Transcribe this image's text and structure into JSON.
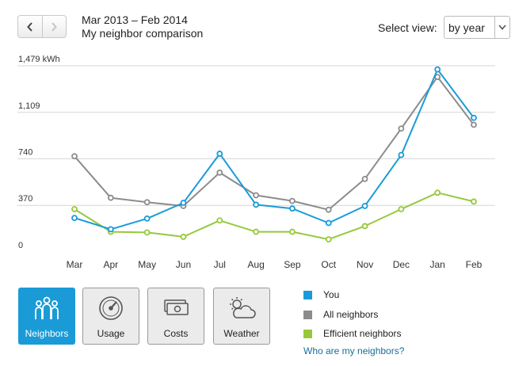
{
  "header": {
    "period": "Mar 2013 – Feb 2014",
    "subtitle": "My neighbor comparison",
    "nav": {
      "prev_icon": "chevron-left-icon",
      "next_icon": "chevron-right-icon"
    },
    "select_label": "Select view:",
    "select_value": "by year"
  },
  "chart_data": {
    "type": "line",
    "unit": "kWh",
    "y_ticks": [
      "0",
      "370",
      "740",
      "1,109",
      "1,479 kWh"
    ],
    "y_tick_values": [
      0,
      370,
      740,
      1109,
      1479
    ],
    "ylim": [
      0,
      1479
    ],
    "categories": [
      "Mar",
      "Apr",
      "May",
      "Jun",
      "Jul",
      "Aug",
      "Sep",
      "Oct",
      "Nov",
      "Dec",
      "Jan",
      "Feb"
    ],
    "grid": true,
    "series": [
      {
        "name": "All neighbors",
        "color": "#8c8c8c",
        "values": [
          760,
          430,
          395,
          365,
          630,
          450,
          405,
          335,
          580,
          980,
          1390,
          1010
        ]
      },
      {
        "name": "Efficient neighbors",
        "color": "#96c93d",
        "values": [
          340,
          160,
          155,
          120,
          250,
          160,
          160,
          100,
          205,
          340,
          470,
          400
        ]
      },
      {
        "name": "You",
        "color": "#1a9bd7",
        "values": [
          270,
          180,
          265,
          390,
          780,
          375,
          345,
          230,
          365,
          770,
          1450,
          1065
        ]
      }
    ]
  },
  "tiles": [
    {
      "label": "Neighbors",
      "icon": "people-icon",
      "active": true
    },
    {
      "label": "Usage",
      "icon": "gauge-icon",
      "active": false
    },
    {
      "label": "Costs",
      "icon": "money-icon",
      "active": false
    },
    {
      "label": "Weather",
      "icon": "sun-cloud-icon",
      "active": false
    }
  ],
  "legend": [
    {
      "label": "You",
      "color": "#1a9bd7"
    },
    {
      "label": "All neighbors",
      "color": "#8c8c8c"
    },
    {
      "label": "Efficient neighbors",
      "color": "#96c93d"
    }
  ],
  "help_link": "Who are my neighbors?"
}
